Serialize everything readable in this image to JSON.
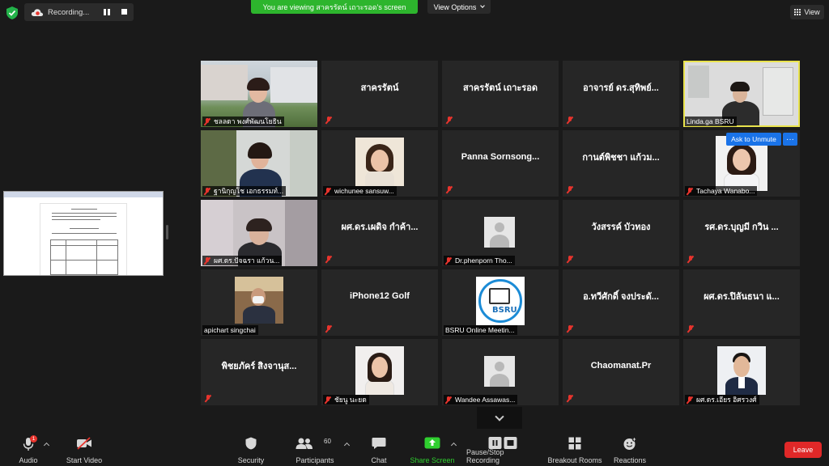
{
  "topbar": {
    "recording_label": "Recording...",
    "viewing_banner": "You are viewing สาครรัตน์ เถาะรอด's screen",
    "view_options_label": "View Options",
    "view_label": "View"
  },
  "tiles": [
    {
      "display": "video",
      "name": "ชลลดา พงศ์พัฒนโยธิน"
    },
    {
      "display": "text",
      "title": "สาครรัตน์"
    },
    {
      "display": "text",
      "title": "สาครรัตน์  เถาะรอด"
    },
    {
      "display": "text",
      "title": "อาจารย์ ดร.สุทิพย์..."
    },
    {
      "display": "video",
      "name": "Linda.ga BSRU",
      "active": true
    },
    {
      "display": "video",
      "name": "ฐานิกุญโช เอกธรรมท์..."
    },
    {
      "display": "photo",
      "name": "wichunee sansuw..."
    },
    {
      "display": "text",
      "title": "Panna  Sornsong..."
    },
    {
      "display": "text",
      "title": "กานต์พิชชา แก้วม..."
    },
    {
      "display": "photo",
      "name": "Tachaya Wanabo..."
    },
    {
      "display": "video",
      "name": "ผศ.ดร.ปัจฉรา แก้วน..."
    },
    {
      "display": "text",
      "title": "ผศ.ดร.เผดิจ กำค้า..."
    },
    {
      "display": "avatar",
      "name": "Dr.phenporn Tho..."
    },
    {
      "display": "text",
      "title": "วังสรรค์ บัวทอง"
    },
    {
      "display": "text",
      "title": "รศ.ดร.บุญมี กวิน ..."
    },
    {
      "display": "photo",
      "name": "apichart singchai"
    },
    {
      "display": "text",
      "title": "iPhone12 Golf"
    },
    {
      "display": "logo",
      "name": "BSRU Online Meetin...",
      "logo_text": "BSRU"
    },
    {
      "display": "text",
      "title": "อ.ทวีศักดิ์ จงประดั..."
    },
    {
      "display": "text",
      "title": "ผศ.ดร.ปิลันธนา แ..."
    },
    {
      "display": "text",
      "title": "พิชยภัคร์ สิงจานุส..."
    },
    {
      "display": "photo",
      "name": "ชัยนู นะยด"
    },
    {
      "display": "avatar",
      "name": "Wandee Assawas..."
    },
    {
      "display": "text",
      "title": "Chaomanat.Pr"
    },
    {
      "display": "photo",
      "name": "ผศ.ดร.เอียร อิศรวงศ์"
    }
  ],
  "overlay": {
    "ask_unmute": "Ask to Unmute",
    "more": "···"
  },
  "toolbar": {
    "audio": "Audio",
    "audio_badge": "1",
    "start_video": "Start Video",
    "security": "Security",
    "participants": "Participants",
    "participants_count": "60",
    "chat": "Chat",
    "share_screen": "Share Screen",
    "pause_stop_recording": "Pause/Stop Recording",
    "breakout_rooms": "Breakout Rooms",
    "reactions": "Reactions",
    "leave": "Leave"
  },
  "colors": {
    "accent_green": "#2db52d",
    "active_speaker": "#e9e34d",
    "leave_red": "#e02828",
    "muted_red": "#e8342d",
    "button_blue": "#1a73e8"
  }
}
